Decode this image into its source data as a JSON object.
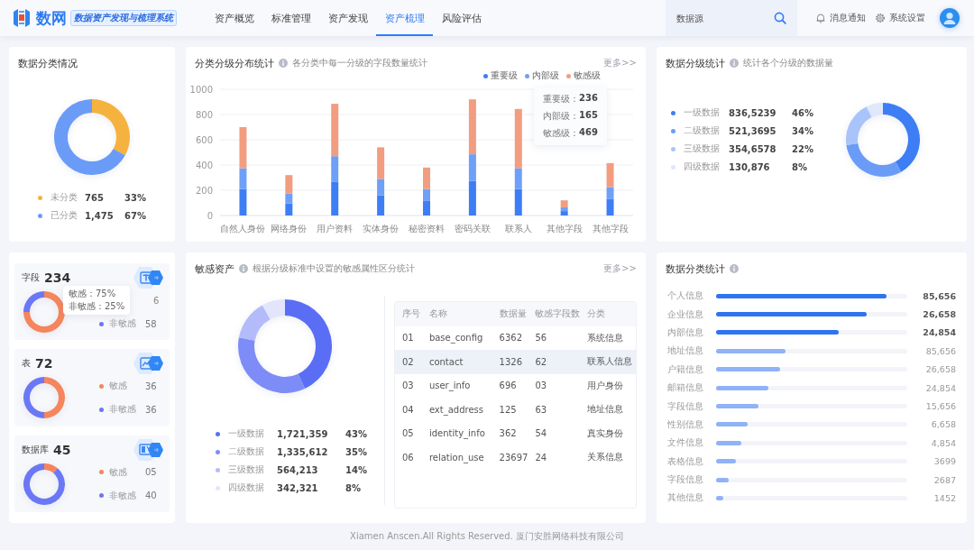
{
  "header": {
    "logo_text": "数网",
    "logo_badge": "数据资产发现与梳理系统",
    "nav": [
      {
        "label": "资产概览",
        "selected": false
      },
      {
        "label": "标准管理",
        "selected": false
      },
      {
        "label": "资产发现",
        "selected": false
      },
      {
        "label": "资产梳理",
        "selected": true
      },
      {
        "label": "风险评估",
        "selected": false
      }
    ],
    "search": {
      "placeholder": "数据源"
    },
    "actions": [
      {
        "label": "消息通知",
        "kind": "bell"
      },
      {
        "label": "系统设置",
        "kind": "gear"
      }
    ]
  },
  "classification": {
    "title": "数据分类情况",
    "chart_data": {
      "type": "donut",
      "categories": [
        "未分类",
        "已分类"
      ],
      "values": [
        33,
        67
      ]
    },
    "legend": [
      {
        "value": "765",
        "percent": "33%",
        "color": "#f6b23e"
      },
      {
        "value": "1,475",
        "percent": "67%",
        "color": "#6a9cf7"
      }
    ]
  },
  "distribution": {
    "title": "分类分级分布统计",
    "subtitle": "各分类中每一分级的字段数量统计",
    "more": "更多>>",
    "chart_data": {
      "type": "bar",
      "stacked": true,
      "grid": true,
      "categories": [
        "自然人身份",
        "网络身份",
        "用户资料",
        "实体身份",
        "秘密资料",
        "密码关联",
        "联系人",
        "其他字段",
        "其他字段"
      ],
      "series": [
        {
          "name": "重要级",
          "color": "#3d7ef5",
          "values": [
            210,
            95,
            265,
            160,
            115,
            275,
            210,
            35,
            130
          ]
        },
        {
          "name": "内部级",
          "color": "#6fa0f8",
          "values": [
            165,
            80,
            205,
            130,
            95,
            210,
            165,
            30,
            95
          ]
        },
        {
          "name": "敏感级",
          "color": "#f29d80",
          "values": [
            325,
            145,
            415,
            250,
            170,
            435,
            469,
            55,
            190
          ]
        }
      ],
      "ylim": [
        0,
        1000
      ],
      "yticks": [
        0,
        200,
        400,
        600,
        800,
        1000
      ]
    },
    "tooltip": [
      {
        "label": "重要级：",
        "value": "236"
      },
      {
        "label": "内部级：",
        "value": "165"
      },
      {
        "label": "敏感级：",
        "value": "469"
      }
    ]
  },
  "grading": {
    "title": "数据分级统计",
    "subtitle": "统计各个分级的数据量",
    "chart_data": {
      "type": "donut",
      "categories": [
        "一级数据",
        "二级数据",
        "三级数据",
        "四级数据"
      ],
      "values": [
        41.8,
        30.9,
        20,
        7.3
      ]
    },
    "legend": [
      {
        "value": "836,5239",
        "percent": "46%",
        "color": "#3d7ef5"
      },
      {
        "value": "521,3695",
        "percent": "34%",
        "color": "#6a9cf7"
      },
      {
        "value": "354,6578",
        "percent": "22%",
        "color": "#a9c4fa"
      },
      {
        "value": "130,876",
        "percent": "8%",
        "color": "#dfe7fb"
      }
    ]
  },
  "summaries": [
    {
      "label": "字段",
      "count": "234",
      "chart_data": {
        "type": "donut",
        "categories": [
          "敏感",
          "非敏感"
        ],
        "values": [
          75,
          25
        ]
      },
      "legend": [
        {
          "value": "6",
          "color": "#f5855c",
          "label_hidden": true
        },
        {
          "value": "58",
          "color": "#6b78f5",
          "label_hidden": false
        }
      ],
      "tooltip": [
        "：75%",
        "：25%"
      ]
    },
    {
      "label": "表",
      "count": "72",
      "chart_data": {
        "type": "donut",
        "categories": [
          "敏感",
          "非敏感"
        ],
        "values": [
          50,
          50
        ]
      },
      "legend": [
        {
          "value": "36",
          "color": "#f5855c",
          "label_hidden": false
        },
        {
          "value": "36",
          "color": "#6b78f5",
          "label_hidden": false
        }
      ]
    },
    {
      "label": "数据库",
      "count": "45",
      "chart_data": {
        "type": "donut",
        "categories": [
          "敏感",
          "非敏感"
        ],
        "values": [
          11.1,
          88.9
        ]
      },
      "legend": [
        {
          "value": "05",
          "color": "#f5855c",
          "label_hidden": false
        },
        {
          "value": "40",
          "color": "#6b78f5",
          "label_hidden": false
        }
      ]
    }
  ],
  "sensitive": {
    "title": "敏感资产",
    "subtitle": "根据分级标准中设置的敏感属性区分统计",
    "more": "更多>>",
    "chart_data": {
      "type": "donut",
      "categories": [
        "一级数据",
        "二级数据",
        "三级数据",
        "四级数据"
      ],
      "values": [
        43,
        35,
        14,
        8
      ]
    },
    "legend": [
      {
        "value": "1,721,359",
        "percent": "43%",
        "color": "#5a6ef5"
      },
      {
        "value": "1,335,612",
        "percent": "35%",
        "color": "#7d8cf7"
      },
      {
        "value": "564,213",
        "percent": "14%",
        "color": "#b4bbfa"
      },
      {
        "value": "342,321",
        "percent": "8%",
        "color": "#e2e5fc"
      }
    ],
    "table": {
      "columns": [
        "序号",
        "名称",
        "数据量",
        "敏感字段数",
        "分类"
      ],
      "rows": [
        {
          "cells": [
            "01",
            "base_config",
            "6362",
            "56",
            "系统信息"
          ],
          "selected": false
        },
        {
          "cells": [
            "02",
            "contact",
            "1326",
            "62",
            "联系人信息"
          ],
          "selected": true
        },
        {
          "cells": [
            "03",
            "user_info",
            "696",
            "03",
            "用户身份"
          ],
          "selected": false
        },
        {
          "cells": [
            "04",
            "ext_address",
            "125",
            "63",
            "地址信息"
          ],
          "selected": false
        },
        {
          "cells": [
            "05",
            "identity_info",
            "362",
            "54",
            "真实身份"
          ],
          "selected": false
        },
        {
          "cells": [
            "06",
            "relation_use",
            "23697",
            "24",
            "关系信息"
          ],
          "selected": false
        }
      ]
    }
  },
  "category_stats": {
    "title": "数据分类统计",
    "items": [
      {
        "label": "个人信息",
        "level": 0.89,
        "value": "85,656",
        "highlighted": true
      },
      {
        "label": "企业信息",
        "level": 0.79,
        "value": "26,658",
        "highlighted": true
      },
      {
        "label": "内部信息",
        "level": 0.64,
        "value": "24,854",
        "highlighted": true
      },
      {
        "label": "地址信息",
        "level": 0.365,
        "value": "85,656",
        "highlighted": false
      },
      {
        "label": "户籍信息",
        "level": 0.335,
        "value": "26,658",
        "highlighted": false
      },
      {
        "label": "邮箱信息",
        "level": 0.275,
        "value": "24,854",
        "highlighted": false
      },
      {
        "label": "字段信息",
        "level": 0.22,
        "value": "15,656",
        "highlighted": false
      },
      {
        "label": "性别信息",
        "level": 0.165,
        "value": "6,658",
        "highlighted": false
      },
      {
        "label": "文件信息",
        "level": 0.13,
        "value": "4,854",
        "highlighted": false
      },
      {
        "label": "表格信息",
        "level": 0.105,
        "value": "3699",
        "highlighted": false
      },
      {
        "label": "字段信息",
        "level": 0.065,
        "value": "2687",
        "highlighted": false
      },
      {
        "label": "其他信息",
        "level": 0.04,
        "value": "1452",
        "highlighted": false
      }
    ]
  },
  "footer": "Xiamen Anscen.All Rights Reserved. 厦门安胜网络科技有限公司"
}
